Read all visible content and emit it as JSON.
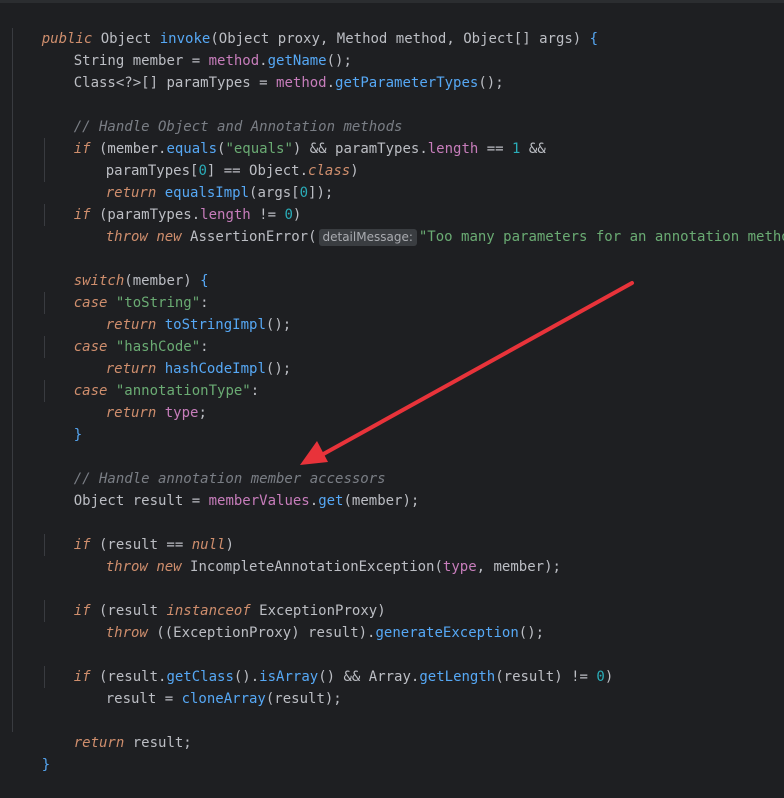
{
  "editor": {
    "lines": [
      {
        "t": [
          "public",
          " ",
          "Object",
          " ",
          "invoke",
          "(",
          "Object",
          " proxy, ",
          "Method",
          " method, ",
          "Object",
          "[] args) ",
          "{"
        ]
      },
      {
        "t": [
          "String",
          " member = ",
          "method",
          ".",
          "getName",
          "();"
        ]
      },
      {
        "t": [
          "Class",
          "<?>[] paramTypes = ",
          "method",
          ".",
          "getParameterTypes",
          "();"
        ]
      },
      {
        "t": [
          ""
        ]
      },
      {
        "t": [
          "// Handle Object and Annotation methods"
        ]
      },
      {
        "t": [
          "if",
          " (member.",
          "equals",
          "(",
          "\"equals\"",
          ") && paramTypes.",
          "length",
          " == ",
          "1",
          " &&"
        ]
      },
      {
        "t": [
          "paramTypes[",
          "0",
          "] == ",
          "Object",
          ".",
          "class",
          ")"
        ]
      },
      {
        "t": [
          "return",
          " ",
          "equalsImpl",
          "(args[",
          "0",
          "]);"
        ]
      },
      {
        "t": [
          "if",
          " (paramTypes.",
          "length",
          " != ",
          "0",
          ")"
        ]
      },
      {
        "t": [
          "throw",
          " ",
          "new",
          " ",
          "AssertionError",
          "(",
          "detailMessage:",
          "\"Too many parameters for an annotation method\"",
          ");"
        ]
      },
      {
        "t": [
          ""
        ]
      },
      {
        "t": [
          "switch",
          "(member) ",
          "{"
        ]
      },
      {
        "t": [
          "case",
          " ",
          "\"toString\"",
          ":"
        ]
      },
      {
        "t": [
          "return",
          " ",
          "toStringImpl",
          "();"
        ]
      },
      {
        "t": [
          "case",
          " ",
          "\"hashCode\"",
          ":"
        ]
      },
      {
        "t": [
          "return",
          " ",
          "hashCodeImpl",
          "();"
        ]
      },
      {
        "t": [
          "case",
          " ",
          "\"annotationType\"",
          ":"
        ]
      },
      {
        "t": [
          "return",
          " ",
          "type",
          ";"
        ]
      },
      {
        "t": [
          "}"
        ]
      },
      {
        "t": [
          ""
        ]
      },
      {
        "t": [
          "// Handle annotation member accessors"
        ]
      },
      {
        "t": [
          "Object",
          " result = ",
          "memberValues",
          ".",
          "get",
          "(member);"
        ]
      },
      {
        "t": [
          ""
        ]
      },
      {
        "t": [
          "if",
          " (result == ",
          "null",
          ")"
        ]
      },
      {
        "t": [
          "throw",
          " ",
          "new",
          " ",
          "IncompleteAnnotationException",
          "(",
          "type",
          ", member);"
        ]
      },
      {
        "t": [
          ""
        ]
      },
      {
        "t": [
          "if",
          " (result ",
          "instanceof",
          " ",
          "ExceptionProxy",
          ")"
        ]
      },
      {
        "t": [
          "throw",
          " ((",
          "ExceptionProxy",
          ") result).",
          "generateException",
          "();"
        ]
      },
      {
        "t": [
          ""
        ]
      },
      {
        "t": [
          "if",
          " (result.",
          "getClass",
          "().",
          "isArray",
          "() && ",
          "Array",
          ".",
          "getLength",
          "(result) != ",
          "0",
          ")"
        ]
      },
      {
        "t": [
          "result = ",
          "cloneArray",
          "(result);"
        ]
      },
      {
        "t": [
          ""
        ]
      },
      {
        "t": [
          "return",
          " result;"
        ]
      },
      {
        "t": [
          "}"
        ]
      }
    ]
  },
  "colors": {
    "background": "#1e1f22",
    "keyword": "#cf8e6d",
    "method": "#56a8f5",
    "field": "#c77dbb",
    "string": "#6aab73",
    "number": "#2aacb8",
    "comment": "#7a7e85",
    "arrow": "#e8333a"
  }
}
